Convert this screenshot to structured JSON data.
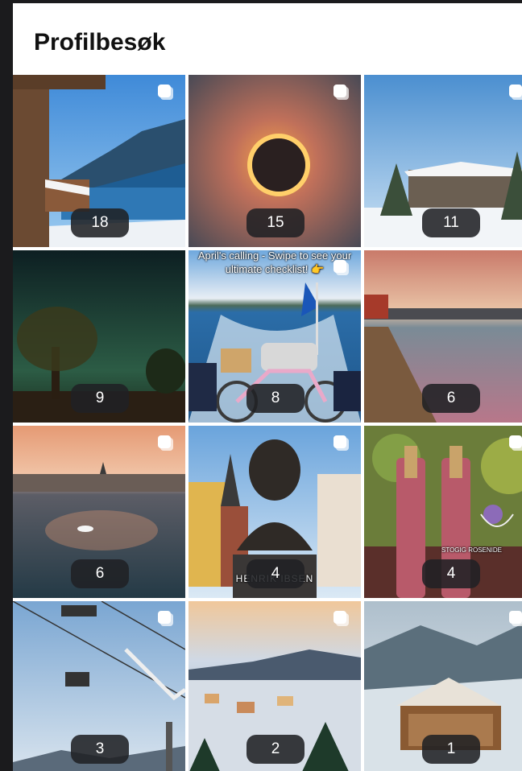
{
  "page": {
    "title": "Profilbesøk"
  },
  "tiles": [
    {
      "count": "18",
      "scene": "cabin-fjord",
      "multi": true
    },
    {
      "count": "15",
      "scene": "solar-eclipse",
      "multi": true
    },
    {
      "count": "11",
      "scene": "snowy-hotel",
      "multi": true
    },
    {
      "count": "9",
      "scene": "night-tree",
      "multi": false
    },
    {
      "count": "8",
      "scene": "boat-bicycle",
      "multi": true,
      "overlay": "April's calling - Swipe to see your ultimate checklist! 👉"
    },
    {
      "count": "6",
      "scene": "harbor-pier",
      "multi": false
    },
    {
      "count": "6",
      "scene": "harbor-sunset",
      "multi": true
    },
    {
      "count": "4",
      "scene": "ibsen-statue",
      "multi": true,
      "statue_label": "HENRIK IBSEN"
    },
    {
      "count": "4",
      "scene": "rose-wine",
      "multi": true,
      "label_text": "STOGIG ROSENIDE"
    },
    {
      "count": "3",
      "scene": "ski-lift",
      "multi": true
    },
    {
      "count": "2",
      "scene": "winter-town",
      "multi": true
    },
    {
      "count": "1",
      "scene": "snowy-bridge",
      "multi": true
    }
  ]
}
